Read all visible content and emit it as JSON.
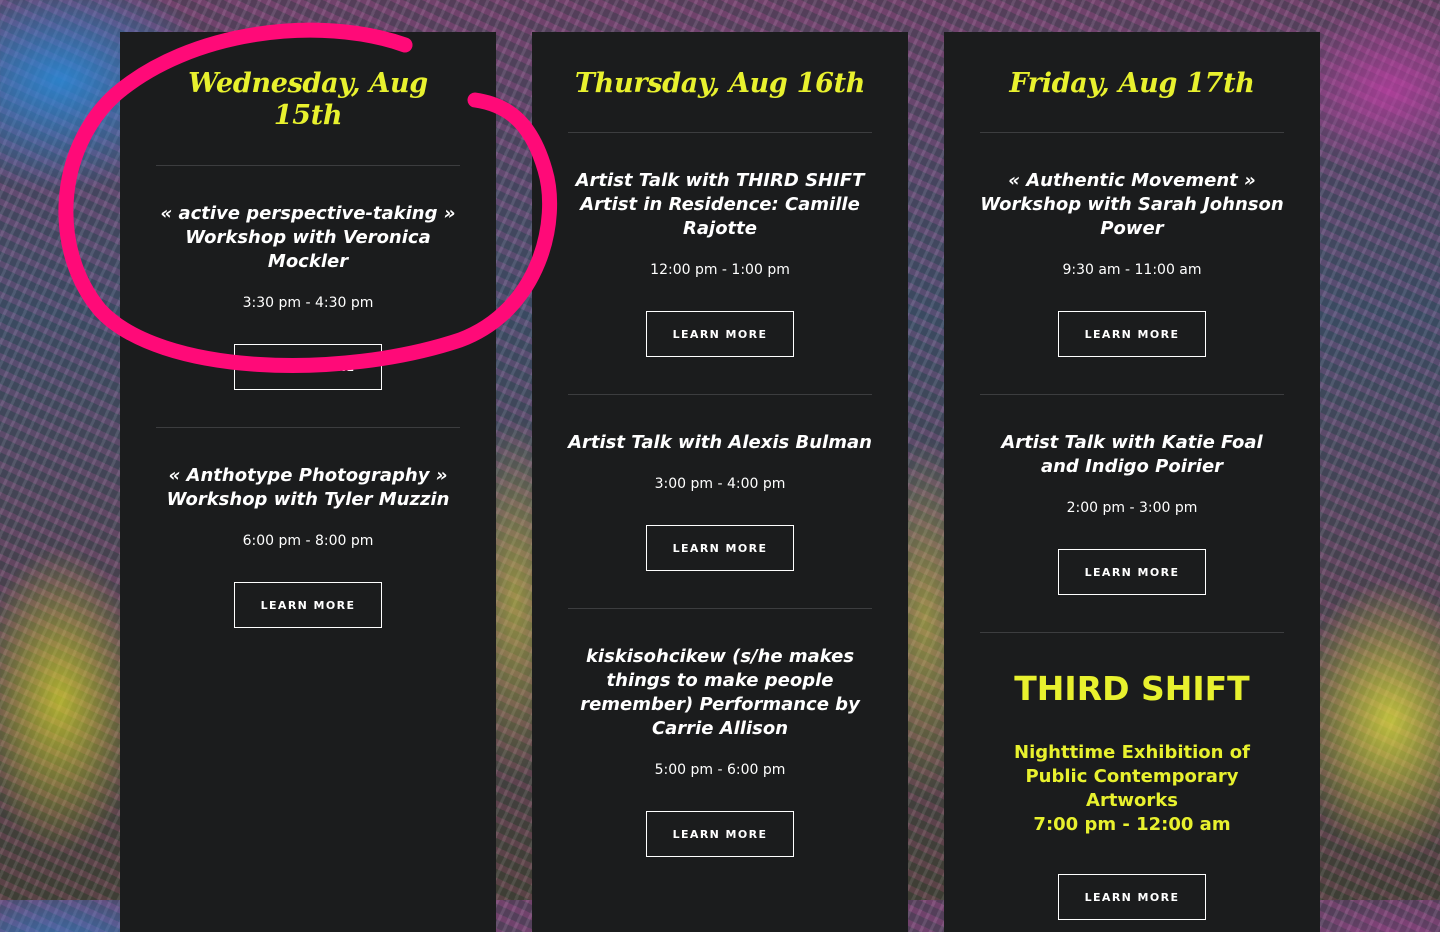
{
  "colors": {
    "accent": "#e8f12e",
    "panel": "#1b1c1d",
    "highlight": "#ff0a78"
  },
  "days": [
    {
      "title": "Wednesday, Aug 15th",
      "events": [
        {
          "title": "« active perspective-taking » Workshop with Veronica Mockler",
          "time": "3:30 pm - 4:30 pm",
          "button": "LEARN MORE"
        },
        {
          "title": "« Anthotype Photography » Workshop with Tyler Muzzin",
          "time": "6:00 pm - 8:00 pm",
          "button": "LEARN MORE"
        }
      ]
    },
    {
      "title": "Thursday, Aug 16th",
      "events": [
        {
          "title": "Artist Talk with THIRD SHIFT Artist in Residence: Camille Rajotte",
          "time": "12:00 pm - 1:00 pm",
          "button": "LEARN MORE"
        },
        {
          "title": "Artist Talk with Alexis Bulman",
          "time": "3:00 pm - 4:00 pm",
          "button": "LEARN MORE"
        },
        {
          "title": "kiskisohcikew (s/he makes things to make people remember) Performance by Carrie Allison",
          "time": "5:00 pm - 6:00 pm",
          "button": "LEARN MORE"
        }
      ]
    },
    {
      "title": "Friday, Aug 17th",
      "events": [
        {
          "title": "« Authentic Movement » Workshop with Sarah Johnson Power",
          "time": "9:30 am - 11:00 am",
          "button": "LEARN MORE"
        },
        {
          "title": "Artist Talk with Katie Foal and Indigo Poirier",
          "time": "2:00 pm - 3:00 pm",
          "button": "LEARN MORE"
        }
      ],
      "feature": {
        "title": "THIRD SHIFT",
        "description": "Nighttime Exhibition of Public Contemporary Artworks",
        "time": "7:00 pm - 12:00 am",
        "button": "LEARN MORE"
      }
    }
  ]
}
